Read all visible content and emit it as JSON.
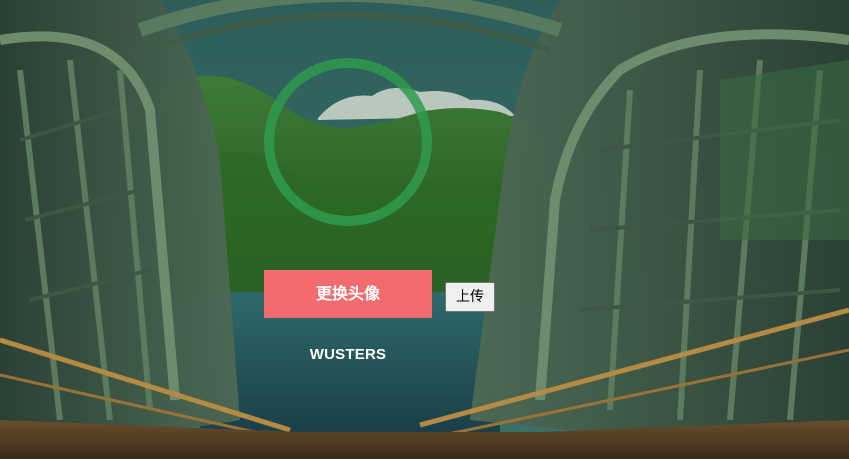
{
  "profile": {
    "change_avatar_label": "更换头像",
    "upload_label": "上传",
    "username": "WUSTERS"
  },
  "colors": {
    "avatar_ring": "#2f9a4e",
    "change_button_bg": "#f26b6e",
    "sky": "#2a5858",
    "mountain": "#2f6a26",
    "lake": "#1d4a55",
    "bridge_steel": "#4a6650",
    "railing": "#b58a43"
  },
  "icons": {
    "background": "bridge-mountain-lake-photo",
    "avatar": "circle-ring-placeholder"
  }
}
